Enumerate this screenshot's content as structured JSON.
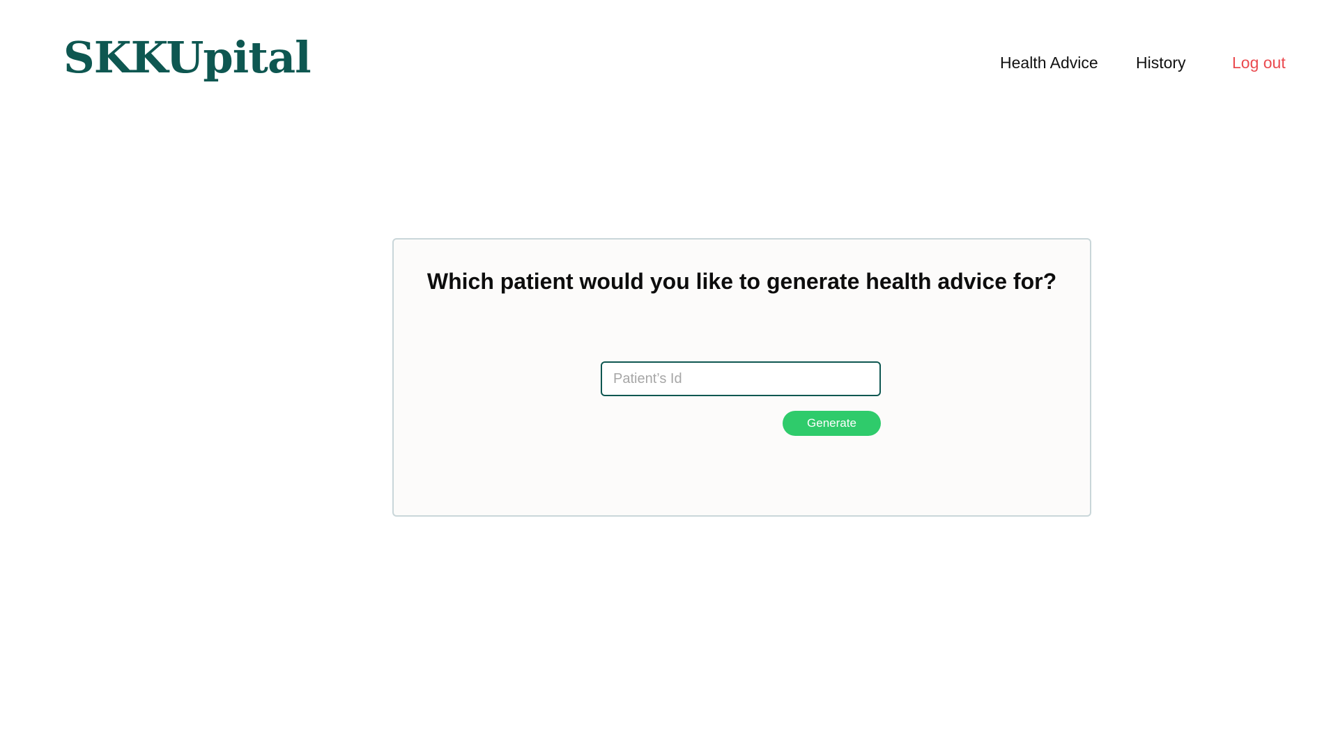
{
  "header": {
    "logo_text": "SKKUpital",
    "nav": {
      "health_advice": "Health Advice",
      "history": "History",
      "log_out": "Log out"
    }
  },
  "main": {
    "card": {
      "title": "Which patient would you like to generate health advice for?",
      "patient_input": {
        "value": "",
        "placeholder": "Patient’s Id"
      },
      "generate_label": "Generate"
    }
  },
  "colors": {
    "brand": "#0e5751",
    "logout": "#ea4a4f",
    "button": "#2fcb6b",
    "card_background": "#fcfbfa",
    "card_border": "#c9d6d9"
  }
}
